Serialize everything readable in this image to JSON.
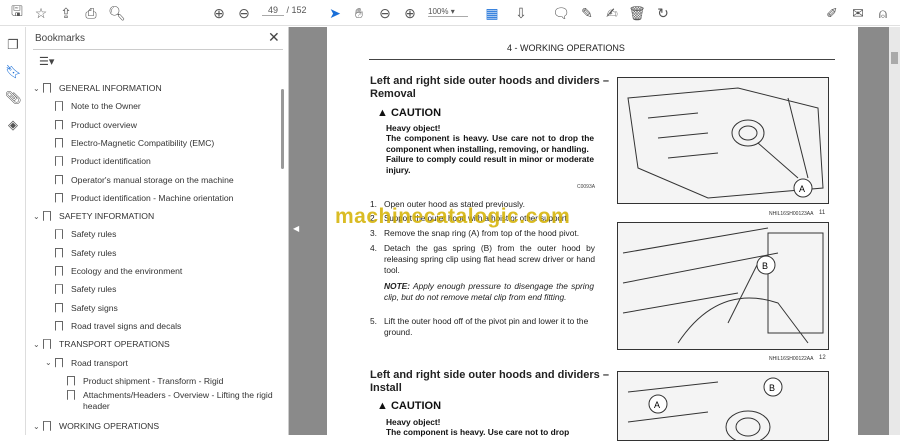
{
  "toolbar": {
    "page_current": "49",
    "page_total": "/ 152",
    "zoom": "100%",
    "icons": [
      "save-icon",
      "star-icon",
      "upload-icon",
      "print-icon",
      "search-icon",
      "page-up-icon",
      "page-down-icon",
      "cursor-icon",
      "hand-icon",
      "zoom-out-icon",
      "zoom-in-icon",
      "fit-icon",
      "scroll-mode-icon",
      "comment-icon",
      "pen-icon",
      "sign-icon",
      "delete-icon",
      "rotate-icon",
      "fill-sign-icon",
      "mail-icon",
      "account-icon"
    ]
  },
  "bookmarks": {
    "title": "Bookmarks",
    "items": [
      {
        "label": "GENERAL INFORMATION",
        "level": 0,
        "expanded": true
      },
      {
        "label": "Note to the Owner",
        "level": 1
      },
      {
        "label": "Product overview",
        "level": 1
      },
      {
        "label": "Electro-Magnetic Compatibility (EMC)",
        "level": 1
      },
      {
        "label": "Product identification",
        "level": 1
      },
      {
        "label": "Operator's manual storage on the machine",
        "level": 1
      },
      {
        "label": "Product identification - Machine orientation",
        "level": 1
      },
      {
        "label": "SAFETY INFORMATION",
        "level": 0,
        "expanded": true
      },
      {
        "label": "Safety rules",
        "level": 1
      },
      {
        "label": "Safety rules",
        "level": 1
      },
      {
        "label": "Ecology and the environment",
        "level": 1
      },
      {
        "label": "Safety rules",
        "level": 1
      },
      {
        "label": "Safety signs",
        "level": 1
      },
      {
        "label": "Road travel signs and decals",
        "level": 1
      },
      {
        "label": "TRANSPORT OPERATIONS",
        "level": 0,
        "expanded": true
      },
      {
        "label": "Road transport",
        "level": 1,
        "expanded": true
      },
      {
        "label": "Product shipment - Transform - Rigid",
        "level": 2
      },
      {
        "label": "Attachments/Headers - Overview - Lifting the rigid header",
        "level": 2
      },
      {
        "label": "WORKING OPERATIONS",
        "level": 0,
        "expanded": true
      }
    ]
  },
  "document": {
    "header": "4 - WORKING OPERATIONS",
    "section1_title": "Left and right side outer hoods and dividers – Removal",
    "caution_label": "CAUTION",
    "caution_heavy": "Heavy object!",
    "caution_text": "The component is heavy.  Use care not to drop the component when installing, removing, or handling.",
    "caution_fail": "Failure to comply could result in minor or moderate injury.",
    "caution_code": "C0093A",
    "steps": [
      {
        "n": "1.",
        "text": "Open outer hood as stated previously."
      },
      {
        "n": "2.",
        "text": "Support the outer hood with a hoist or other support."
      },
      {
        "n": "3.",
        "text": "Remove the snap ring (A) from top of the hood pivot."
      },
      {
        "n": "4.",
        "text": "Detach the gas spring (B) from the outer hood by releasing spring clip using flat head screw driver or hand tool."
      },
      {
        "n": "5.",
        "text": "Lift the outer hood off of the pivot pin and lower it to the ground."
      }
    ],
    "note_label": "NOTE:",
    "note_text": " Apply enough pressure to disengage the spring clip, but do not remove metal clip from end fitting.",
    "section2_title": "Left and right side outer hoods and dividers – Install",
    "caution2_label": "CAUTION",
    "caution2_heavy": "Heavy object!",
    "caution2_text": "The component is heavy.  Use care not to drop",
    "figures": [
      {
        "callouts": [
          "A"
        ],
        "label": "NHIL16SH00123AA",
        "num": "11"
      },
      {
        "callouts": [
          "B"
        ],
        "label": "NHIL16SH00122AA",
        "num": "12"
      },
      {
        "callouts": [
          "A",
          "B"
        ]
      }
    ]
  },
  "watermark": "machinecatalogic.com"
}
